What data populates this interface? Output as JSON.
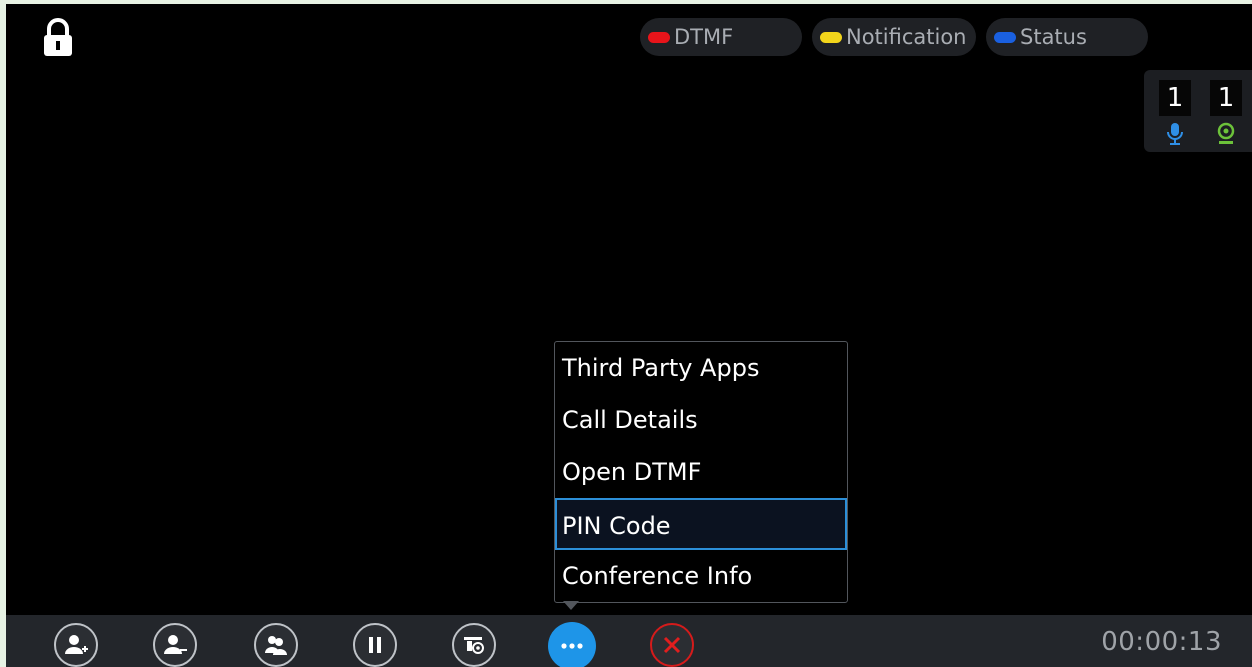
{
  "legend": [
    {
      "label": "DTMF",
      "color": "#e8141a"
    },
    {
      "label": "Notification",
      "color": "#f2d51b"
    },
    {
      "label": "Status",
      "color": "#1a60e0"
    }
  ],
  "stats": {
    "mic_count": "1",
    "camera_count": "1"
  },
  "menu": {
    "items": [
      {
        "label": "Third Party Apps"
      },
      {
        "label": "Call Details"
      },
      {
        "label": "Open DTMF"
      },
      {
        "label": "PIN Code",
        "selected": true
      },
      {
        "label": "Conference Info"
      }
    ]
  },
  "toolbar": {
    "buttons": [
      {
        "icon": "add-participant-icon"
      },
      {
        "icon": "remove-participant-icon"
      },
      {
        "icon": "participants-icon"
      },
      {
        "icon": "hold-icon"
      },
      {
        "icon": "presentation-icon"
      },
      {
        "icon": "more-icon"
      },
      {
        "icon": "end-call-icon"
      }
    ],
    "timer": "00:00:13"
  }
}
